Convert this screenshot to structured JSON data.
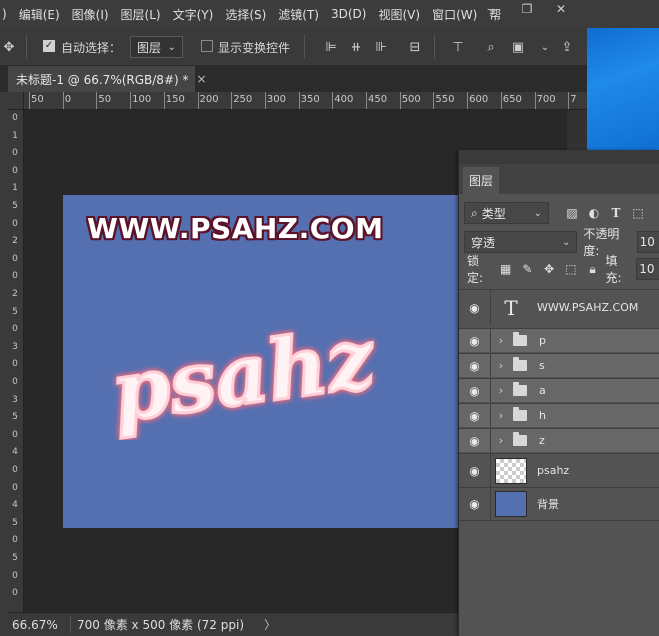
{
  "menubar": {
    "items": [
      ")",
      "编辑(E)",
      "图像(I)",
      "图层(L)",
      "文字(Y)",
      "选择(S)",
      "滤镜(T)",
      "3D(D)",
      "视图(V)",
      "窗口(W)",
      "帮"
    ]
  },
  "window_controls": {
    "minimize": "—",
    "restore": "❐",
    "close": "✕"
  },
  "options": {
    "auto_select_label": "自动选择：",
    "auto_select_checked": true,
    "auto_select_value": "图层",
    "show_transform_label": "显示变换控件",
    "show_transform_checked": false
  },
  "tab": {
    "title": "未标题-1 @ 66.7%(RGB/8#) *",
    "close": "×"
  },
  "ruler": {
    "top_labels": [
      "50",
      "0",
      "50",
      "100",
      "150",
      "200",
      "250",
      "300",
      "350",
      "400",
      "450",
      "500",
      "550",
      "600",
      "650",
      "700",
      "7"
    ],
    "left_labels": [
      "0",
      "1",
      "0",
      "0",
      "1",
      "5",
      "0",
      "2",
      "0",
      "0",
      "2",
      "5",
      "0",
      "3",
      "0",
      "0",
      "3",
      "5",
      "0",
      "4",
      "0",
      "0",
      "4",
      "5",
      "0",
      "5",
      "0",
      "0"
    ]
  },
  "canvas": {
    "headline": "WWW.PSAHZ.COM",
    "script_text": "psahz",
    "background_color": "#5570b1",
    "headline_outline_color": "#5b1329",
    "script_glow_color": "#f26b7e"
  },
  "status": {
    "zoom": "66.67%",
    "doc_size": "700 像素 x 500 像素 (72 ppi)",
    "arrow": "〉"
  },
  "layers_panel": {
    "tab_label": "图层",
    "filter_kind": "类型",
    "blend_mode": "穿透",
    "opacity_label": "不透明度:",
    "opacity_value": "10",
    "lock_label": "锁定:",
    "fill_label": "填充:",
    "fill_value": "10",
    "layers": [
      {
        "name": "WWW.PSAHZ.COM",
        "kind": "text",
        "selected": false
      },
      {
        "name": "p",
        "kind": "group",
        "selected": true
      },
      {
        "name": "s",
        "kind": "group",
        "selected": true
      },
      {
        "name": "a",
        "kind": "group",
        "selected": true
      },
      {
        "name": "h",
        "kind": "group",
        "selected": true
      },
      {
        "name": "z",
        "kind": "group",
        "selected": true
      },
      {
        "name": "psahz",
        "kind": "smart",
        "selected": false
      },
      {
        "name": "背景",
        "kind": "fill",
        "selected": false
      }
    ]
  }
}
